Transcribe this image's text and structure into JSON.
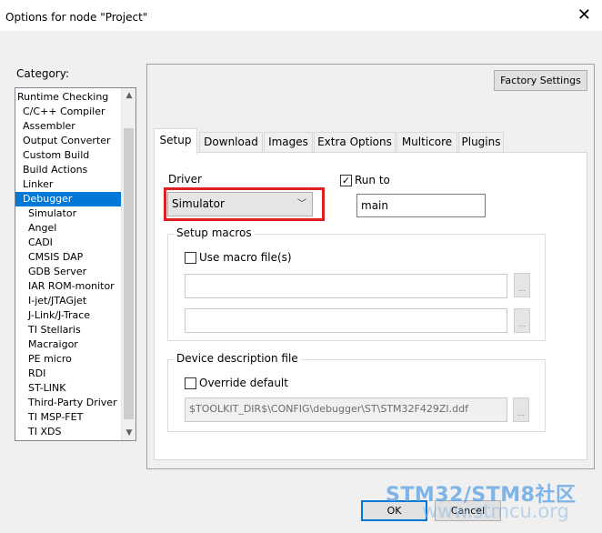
{
  "window": {
    "title": "Options for node \"Project\"",
    "close_glyph": "✕"
  },
  "category": {
    "label": "Category:",
    "items": [
      {
        "label": "Runtime Checking",
        "level": 0
      },
      {
        "label": "C/C++ Compiler",
        "level": 1
      },
      {
        "label": "Assembler",
        "level": 1
      },
      {
        "label": "Output Converter",
        "level": 1
      },
      {
        "label": "Custom Build",
        "level": 1
      },
      {
        "label": "Build Actions",
        "level": 1
      },
      {
        "label": "Linker",
        "level": 1
      },
      {
        "label": "Debugger",
        "level": 1,
        "selected": true
      },
      {
        "label": "Simulator",
        "level": 2
      },
      {
        "label": "Angel",
        "level": 2
      },
      {
        "label": "CADI",
        "level": 2
      },
      {
        "label": "CMSIS DAP",
        "level": 2
      },
      {
        "label": "GDB Server",
        "level": 2
      },
      {
        "label": "IAR ROM-monitor",
        "level": 2
      },
      {
        "label": "I-jet/JTAGjet",
        "level": 2
      },
      {
        "label": "J-Link/J-Trace",
        "level": 2
      },
      {
        "label": "TI Stellaris",
        "level": 2
      },
      {
        "label": "Macraigor",
        "level": 2
      },
      {
        "label": "PE micro",
        "level": 2
      },
      {
        "label": "RDI",
        "level": 2
      },
      {
        "label": "ST-LINK",
        "level": 2
      },
      {
        "label": "Third-Party Driver",
        "level": 2
      },
      {
        "label": "TI MSP-FET",
        "level": 2
      },
      {
        "label": "TI XDS",
        "level": 2
      }
    ]
  },
  "factory_settings_label": "Factory Settings",
  "tabs": [
    "Setup",
    "Download",
    "Images",
    "Extra Options",
    "Multicore",
    "Plugins"
  ],
  "setup": {
    "driver_label": "Driver",
    "driver_value": "Simulator",
    "run_to_label": "Run to",
    "run_to_checked": true,
    "run_to_value": "main",
    "macros_group": "Setup macros",
    "use_macro_label": "Use macro file(s)",
    "use_macro_checked": false,
    "device_group": "Device description file",
    "override_label": "Override default",
    "override_checked": false,
    "ddf_path": "$TOOLKIT_DIR$\\CONFIG\\debugger\\ST\\STM32F429ZI.ddf",
    "browse_label": "..."
  },
  "buttons": {
    "ok": "OK",
    "cancel": "Cancel"
  },
  "watermark": {
    "title": "STM32/STM8社区",
    "url": "www.stmcu.org"
  },
  "colors": {
    "selection": "#0078d7",
    "highlight_box": "#e02020"
  }
}
